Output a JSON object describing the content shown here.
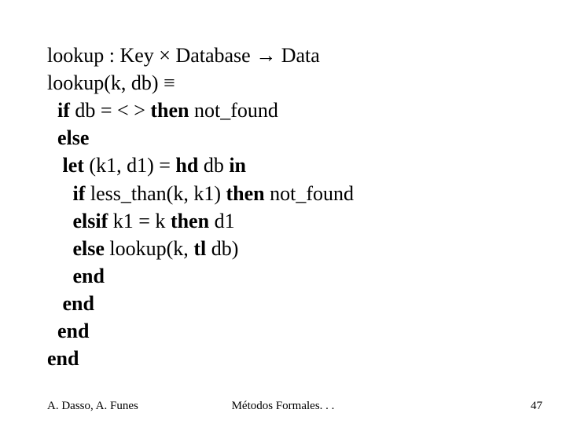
{
  "code": {
    "l1_a": "lookup : Key ",
    "l1_b": " Database ",
    "l1_c": " Data",
    "sym_times": "×",
    "sym_arrow": "→",
    "l2_a": "lookup(k, db) ",
    "sym_equiv": "≡",
    "l3_if": "if",
    "l3_mid": " db = < > ",
    "l3_then": "then",
    "l3_end": " not_found",
    "l4_else": "else",
    "l5_let": "let",
    "l5_mid": " (k1, d1) = ",
    "l5_hd": "hd",
    "l5_end": " db ",
    "l5_in": "in",
    "l6_if": "if",
    "l6_mid": " less_than(k, k1) ",
    "l6_then": "then",
    "l6_end": " not_found",
    "l7_elsif": "elsif",
    "l7_mid": " k1 = k ",
    "l7_then": "then",
    "l7_end": " d1",
    "l8_else": "else",
    "l8_mid": " lookup(k, ",
    "l8_tl": "tl",
    "l8_end": " db)",
    "l9_end": "end",
    "l10_end": "end",
    "l11_end": "end",
    "l12_end": "end"
  },
  "footer": {
    "authors": "A. Dasso, A. Funes",
    "title": "Métodos Formales. . .",
    "page": "47"
  }
}
